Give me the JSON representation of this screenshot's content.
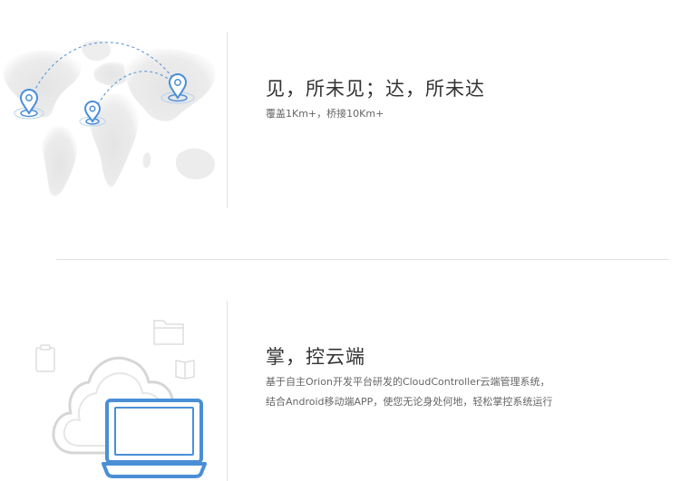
{
  "features": {
    "coverage": {
      "title": "见，所未见；达，所未达",
      "description": "覆盖1Km+，桥接10Km+"
    },
    "control": {
      "title": "掌，控云端",
      "description_line1": "基于自主Orion开发平台研发的CloudController云端管理系统，",
      "description_line2": "结合Android移动端APP，使您无论身处何地，轻松掌控系统运行"
    }
  },
  "colors": {
    "accent": "#4a8fd6",
    "map": "#e6e6e6",
    "cloud": "#d6d6d6"
  },
  "icons": [
    "world-map-icon",
    "location-pin-icon",
    "cloud-icon",
    "laptop-icon",
    "folder-icon",
    "clipboard-icon",
    "book-icon"
  ]
}
